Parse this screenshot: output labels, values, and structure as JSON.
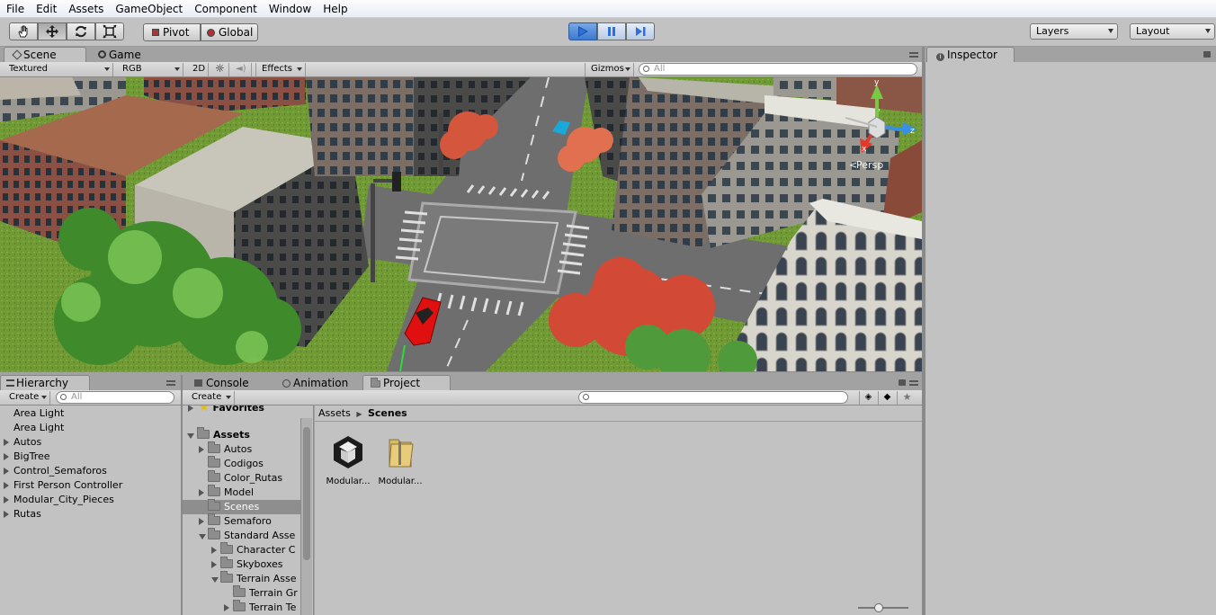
{
  "menu": [
    "File",
    "Edit",
    "Assets",
    "GameObject",
    "Component",
    "Window",
    "Help"
  ],
  "toolbar": {
    "pivot_label": "Pivot",
    "global_label": "Global",
    "layers_label": "Layers",
    "layout_label": "Layout",
    "play_active": true
  },
  "scene": {
    "tabs": [
      "Scene",
      "Game"
    ],
    "active_tab": "Scene",
    "draw_mode": "Textured",
    "render_mode": "RGB",
    "mode_2d": "2D",
    "effects_label": "Effects",
    "gizmos_label": "Gizmos",
    "search_placeholder": "All",
    "gizmo_axes": [
      "y",
      "z",
      "x"
    ],
    "persp_label": "Persp"
  },
  "inspector": {
    "tab_label": "Inspector"
  },
  "hierarchy": {
    "tab_label": "Hierarchy",
    "create_label": "Create",
    "search_placeholder": "All",
    "items": [
      {
        "label": "Area Light",
        "expandable": false
      },
      {
        "label": "Area Light",
        "expandable": false
      },
      {
        "label": "Autos",
        "expandable": true
      },
      {
        "label": "BigTree",
        "expandable": true
      },
      {
        "label": "Control_Semaforos",
        "expandable": true
      },
      {
        "label": "First Person Controller",
        "expandable": true
      },
      {
        "label": "Modular_City_Pieces",
        "expandable": true
      },
      {
        "label": "Rutas",
        "expandable": true
      }
    ]
  },
  "bottom_tabs": [
    "Console",
    "Animation",
    "Project"
  ],
  "project": {
    "create_label": "Create",
    "favorites_label": "Favorites",
    "assets_label": "Assets",
    "tree": [
      {
        "label": "Autos",
        "arrow": "closed",
        "selected": false
      },
      {
        "label": "Codigos",
        "arrow": "none",
        "selected": false
      },
      {
        "label": "Color_Rutas",
        "arrow": "none",
        "selected": false
      },
      {
        "label": "Model",
        "arrow": "closed",
        "selected": false
      },
      {
        "label": "Scenes",
        "arrow": "none",
        "selected": true
      },
      {
        "label": "Semaforo",
        "arrow": "closed",
        "selected": false
      },
      {
        "label": "Standard Asse",
        "arrow": "open",
        "selected": false
      },
      {
        "label": "Character C",
        "arrow": "closed",
        "selected": false
      },
      {
        "label": "Skyboxes",
        "arrow": "closed",
        "selected": false
      },
      {
        "label": "Terrain Asse",
        "arrow": "open",
        "selected": false
      },
      {
        "label": "Terrain Gr",
        "arrow": "none",
        "selected": false
      },
      {
        "label": "Terrain Te",
        "arrow": "closed",
        "selected": false
      }
    ],
    "breadcrumb": [
      "Assets",
      "Scenes"
    ],
    "files": [
      {
        "label": "Modular...",
        "icon": "unity-scene-icon"
      },
      {
        "label": "Modular...",
        "icon": "folder-file-icon"
      }
    ]
  }
}
